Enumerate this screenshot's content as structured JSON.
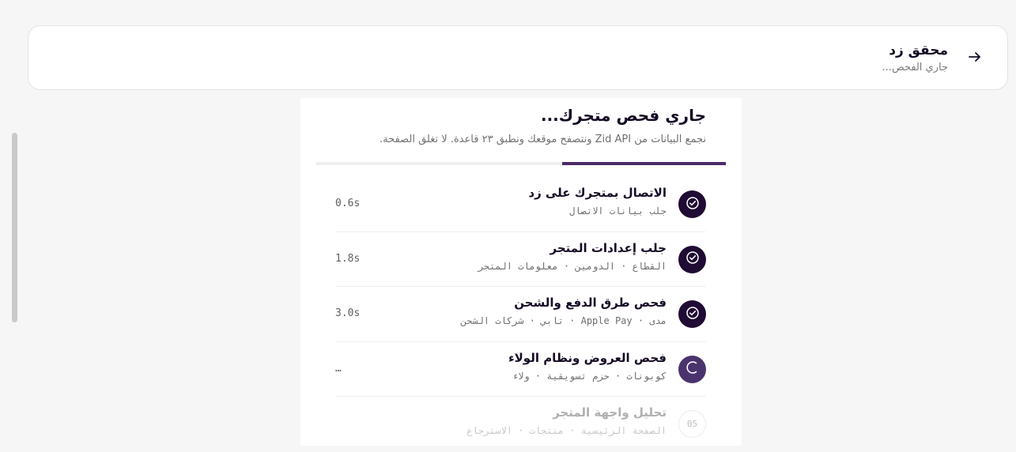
{
  "header": {
    "title": "محقق زد",
    "status": "جاري الفحص..."
  },
  "main": {
    "title": "جاري فحص متجرك...",
    "subtitle": "نجمع البيانات من Zid API ونتصفح موقعك ونطبق ٢٣ قاعدة. لا تغلق الصفحة.",
    "progress_percent": 40
  },
  "steps": [
    {
      "title": "الاتصال بمتجرك على زد",
      "detail": "جلب بيانات الاتصال",
      "time": "0.6s",
      "state": "done"
    },
    {
      "title": "جلب إعدادات المتجر",
      "detail": "القطاع · الدومين · معلومات المتجر",
      "time": "1.8s",
      "state": "done"
    },
    {
      "title": "فحص طرق الدفع والشحن",
      "detail": "مدى · Apple Pay · تابي · شركات الشحن",
      "time": "3.0s",
      "state": "done"
    },
    {
      "title": "فحص العروض ونظام الولاء",
      "detail": "كوبونات · حزم تسويقية · ولاء",
      "time": "…",
      "state": "active"
    },
    {
      "title": "تحليل واجهة المتجر",
      "detail": "الصفحة الرئيسية · منتجات · الاسترجاع",
      "number": "05",
      "time": "",
      "state": "pending"
    }
  ],
  "icons": {
    "back": "arrow-right-icon",
    "done": "check-circle-icon",
    "active": "spinner-icon"
  },
  "colors": {
    "accent": "#4a2a6b",
    "done": "#1f0b33",
    "active": "#4b336d"
  }
}
